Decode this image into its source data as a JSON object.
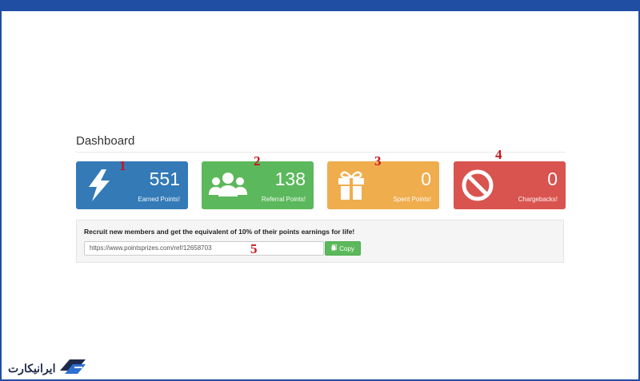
{
  "page": {
    "title": "Dashboard"
  },
  "colors": {
    "frame": "#1f4ea3",
    "blue": "#337ab7",
    "green": "#5cb85c",
    "orange": "#f0ad4e",
    "red": "#d9534f",
    "marker": "#c9141b"
  },
  "stats": [
    {
      "icon": "lightning-bolt-icon",
      "value": "551",
      "label": "Earned Points!",
      "marker": "1"
    },
    {
      "icon": "users-group-icon",
      "value": "138",
      "label": "Referral Points!",
      "marker": "2"
    },
    {
      "icon": "gift-icon",
      "value": "0",
      "label": "Spent Points!",
      "marker": "3"
    },
    {
      "icon": "prohibited-icon",
      "value": "0",
      "label": "Chargebacks!",
      "marker": "4"
    }
  ],
  "referral": {
    "text": "Recruit new members and get the equivalent of 10% of their points earnings for life!",
    "url": "https://www.pointsprizes.com/ref/12658703",
    "copy_label": "Copy",
    "marker": "5"
  },
  "brand": {
    "name": "ایرانیکارت"
  }
}
